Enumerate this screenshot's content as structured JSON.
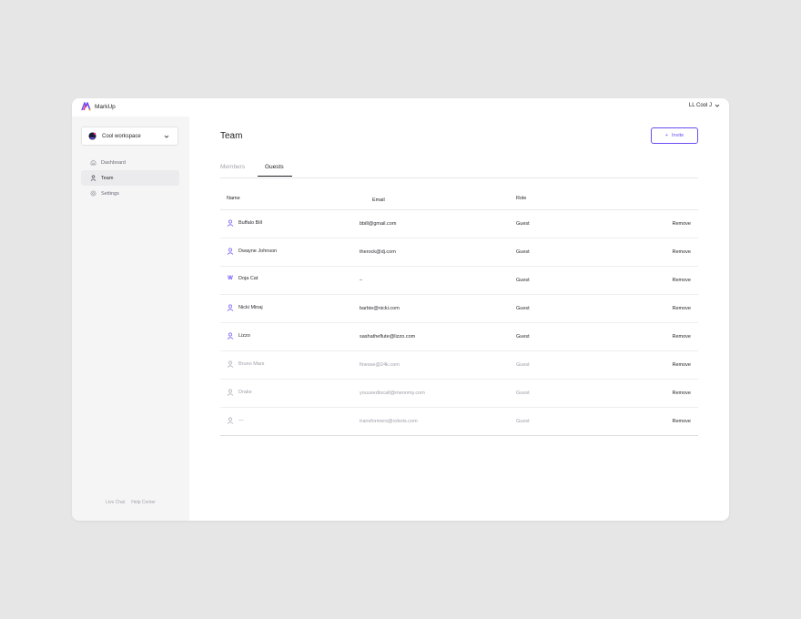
{
  "app": {
    "brand": "MarkUp",
    "user": "LL Cool J"
  },
  "sidebar": {
    "workspace": "Cool workspace",
    "items": [
      {
        "label": "Dashboard",
        "icon": "home-icon",
        "active": false
      },
      {
        "label": "Team",
        "icon": "user-icon",
        "active": true
      },
      {
        "label": "Settings",
        "icon": "gear-icon",
        "active": false
      }
    ],
    "footer": {
      "live_chat": "Live Chat",
      "help_center": "Help Center"
    }
  },
  "main": {
    "title": "Team",
    "invite_label": "Invite",
    "tabs": [
      {
        "label": "Members",
        "active": false
      },
      {
        "label": "Guests",
        "active": true
      }
    ],
    "table": {
      "headers": {
        "name": "Name",
        "email": "Email",
        "role": "Role"
      },
      "rows": [
        {
          "name": "Buffalo Bill",
          "email": "bbill@gmail.com",
          "role": "Guest",
          "action": "Remove",
          "icon": "user-icon",
          "status": "active"
        },
        {
          "name": "Dwayne Johnson",
          "email": "therock@dj.com",
          "role": "Guest",
          "action": "Remove",
          "icon": "user-icon",
          "status": "active"
        },
        {
          "name": "Doja Cat",
          "email": "–",
          "role": "Guest",
          "action": "Remove",
          "icon": "letter-w-icon",
          "letter": "W",
          "status": "active"
        },
        {
          "name": "Nicki Minaj",
          "email": "barbie@nicki.com",
          "role": "Guest",
          "action": "Remove",
          "icon": "user-icon",
          "status": "active"
        },
        {
          "name": "Lizzo",
          "email": "sashatheflute@lizzo.com",
          "role": "Guest",
          "action": "Remove",
          "icon": "user-icon",
          "status": "active"
        },
        {
          "name": "Bruno Mars",
          "email": "finesse@24k.com",
          "role": "Guest",
          "action": "Remove",
          "icon": "user-icon",
          "status": "pending"
        },
        {
          "name": "Drake",
          "email": "youusedtocall@meonmy.com",
          "role": "Guest",
          "action": "Remove",
          "icon": "user-icon",
          "status": "pending"
        },
        {
          "name": "—",
          "email": "transformers@robots.com",
          "role": "Guest",
          "action": "Remove",
          "icon": "user-icon",
          "status": "pending"
        }
      ]
    }
  },
  "colors": {
    "accent": "#6c4cf4",
    "sidebar_bg": "#f5f5f6",
    "page_bg": "#e6e6e6"
  }
}
